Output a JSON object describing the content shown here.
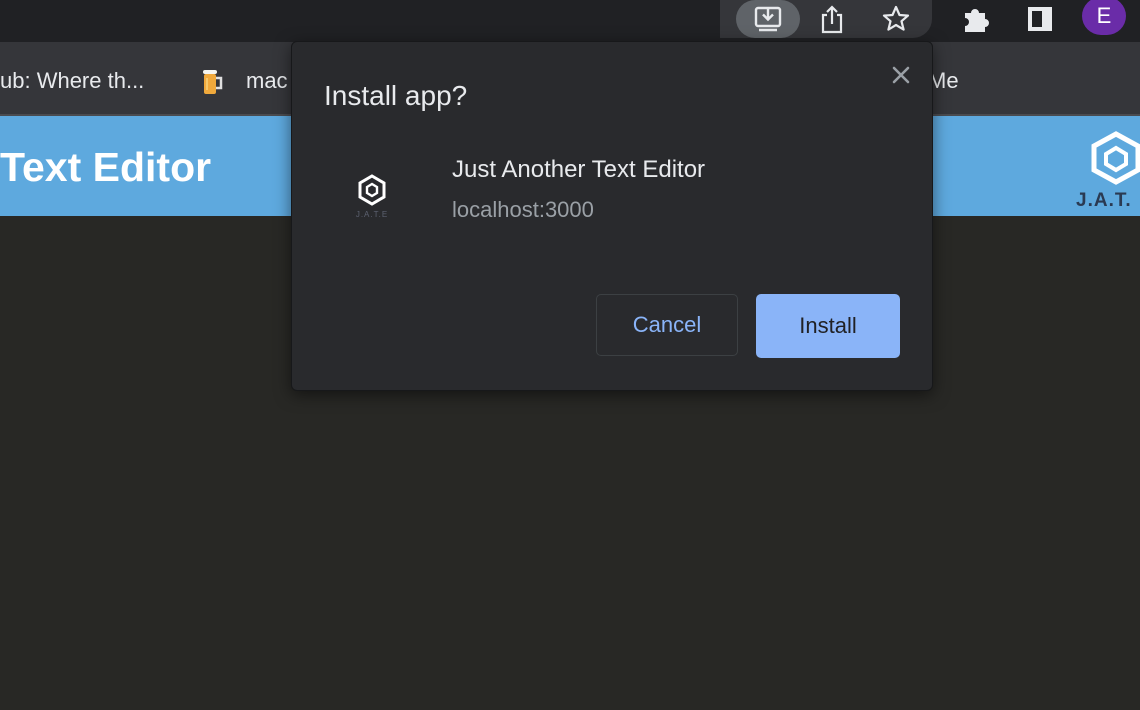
{
  "toolbar": {
    "icons": [
      "install-app-icon",
      "share-icon",
      "bookmark-star-icon",
      "extensions-puzzle-icon",
      "side-panel-icon"
    ],
    "profile_initial": "E",
    "profile_color": "#6a2ca8"
  },
  "bookmarks": {
    "items": [
      {
        "label": "ub: Where th..."
      },
      {
        "label": "mac",
        "icon": "beer-mug-icon"
      },
      {
        "label": "Me"
      }
    ]
  },
  "page": {
    "title": "Text Editor",
    "logo_text": "J.A.T.",
    "header_color": "#5ea9de"
  },
  "dialog": {
    "title": "Install app?",
    "app_name": "Just Another Text Editor",
    "app_origin": "localhost:3000",
    "app_icon_text": "J.A.T.E",
    "cancel_label": "Cancel",
    "install_label": "Install",
    "accent_color": "#8ab4f8"
  }
}
